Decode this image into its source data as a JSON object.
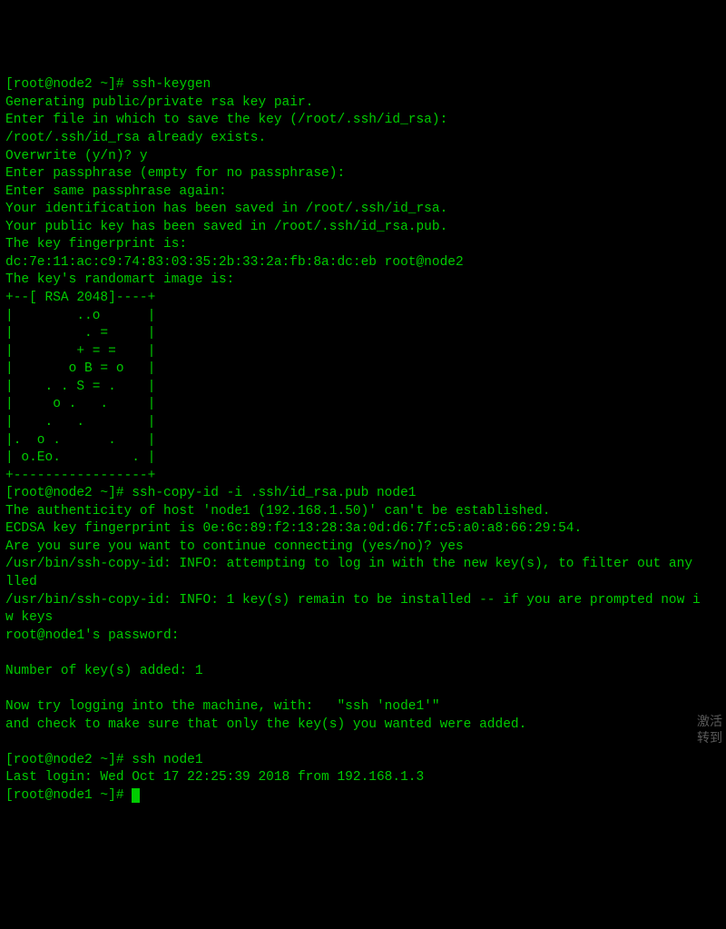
{
  "lines": {
    "l1_prompt": "[root@node2 ~]# ",
    "l1_cmd": "ssh-keygen",
    "l2": "Generating public/private rsa key pair.",
    "l3": "Enter file in which to save the key (/root/.ssh/id_rsa):",
    "l4": "/root/.ssh/id_rsa already exists.",
    "l5": "Overwrite (y/n)? y",
    "l6": "Enter passphrase (empty for no passphrase):",
    "l7": "Enter same passphrase again:",
    "l8": "Your identification has been saved in /root/.ssh/id_rsa.",
    "l9": "Your public key has been saved in /root/.ssh/id_rsa.pub.",
    "l10": "The key fingerprint is:",
    "l11": "dc:7e:11:ac:c9:74:83:03:35:2b:33:2a:fb:8a:dc:eb root@node2",
    "l12": "The key's randomart image is:",
    "l13": "+--[ RSA 2048]----+",
    "l14": "|        ..o      |",
    "l15": "|         . =     |",
    "l16": "|        + = =    |",
    "l17": "|       o B = o   |",
    "l18": "|    . . S = .    |",
    "l19": "|     o .   .     |",
    "l20": "|    .   .        |",
    "l21": "|.  o .      .    |",
    "l22": "| o.Eo.         . |",
    "l23": "+-----------------+",
    "l24_prompt": "[root@node2 ~]# ",
    "l24_cmd": "ssh-copy-id -i .ssh/id_rsa.pub node1",
    "l25": "The authenticity of host 'node1 (192.168.1.50)' can't be established.",
    "l26": "ECDSA key fingerprint is 0e:6c:89:f2:13:28:3a:0d:d6:7f:c5:a0:a8:66:29:54.",
    "l27": "Are you sure you want to continue connecting (yes/no)? yes",
    "l28": "/usr/bin/ssh-copy-id: INFO: attempting to log in with the new key(s), to filter out any ",
    "l29": "lled",
    "l30": "/usr/bin/ssh-copy-id: INFO: 1 key(s) remain to be installed -- if you are prompted now i",
    "l31": "w keys",
    "l32": "root@node1's password:",
    "l33": "",
    "l34": "Number of key(s) added: 1",
    "l35": "",
    "l36": "Now try logging into the machine, with:   \"ssh 'node1'\"",
    "l37": "and check to make sure that only the key(s) you wanted were added.",
    "l38": "",
    "l39_prompt": "[root@node2 ~]# ",
    "l39_cmd": "ssh node1",
    "l40": "Last login: Wed Oct 17 22:25:39 2018 from 192.168.1.3",
    "l41_prompt": "[root@node1 ~]# "
  },
  "watermark": {
    "line1": "激活",
    "line2": "转到"
  }
}
